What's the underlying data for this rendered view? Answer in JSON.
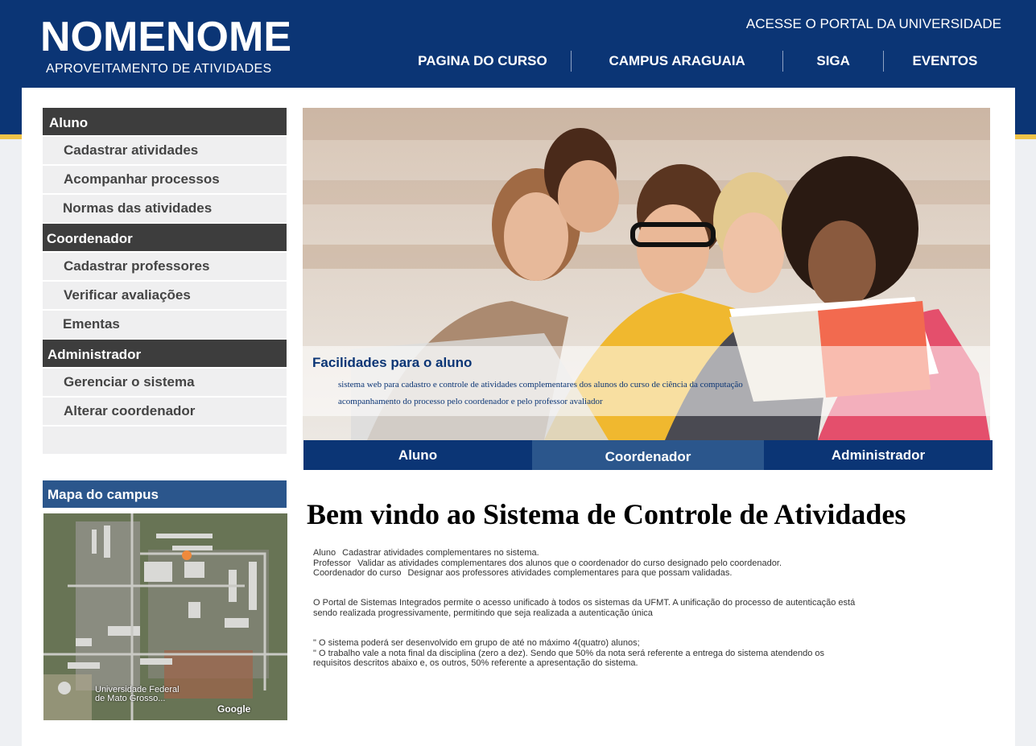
{
  "header": {
    "title": "NOMENOME",
    "subtitle": "APROVEITAMENTO DE ATIVIDADES",
    "portal_link": "ACESSE O PORTAL DA UNIVERSIDADE",
    "nav": [
      "PAGINA DO CURSO",
      "CAMPUS ARAGUAIA",
      "SIGA",
      "EVENTOS"
    ]
  },
  "sidebar": {
    "groups": [
      {
        "title": "Aluno",
        "items": [
          "Cadastrar atividades",
          "Acompanhar processos",
          "Normas das atividades"
        ]
      },
      {
        "title": "Coordenador",
        "items": [
          "Cadastrar professores",
          "Verificar avaliações",
          "Ementas"
        ]
      },
      {
        "title": "Administrador",
        "items": [
          "Gerenciar o sistema",
          "Alterar coordenador"
        ]
      }
    ]
  },
  "map": {
    "title": "Mapa do campus",
    "label_line1": "Universidade Federal",
    "label_line2": "de Mato Grosso...",
    "brand": "Google"
  },
  "hero": {
    "title": "Facilidades para o aluno",
    "line1": "sistema web para cadastro e controle de atividades complementares dos alunos do curso de ciência da computação",
    "line2": "acompanhamento do processo pelo coordenador e pelo professor avaliador"
  },
  "tabs": {
    "items": [
      "Aluno",
      "Coordenador",
      "Administrador"
    ],
    "active": "Coordenador"
  },
  "main": {
    "welcome": "Bem vindo ao Sistema de Controle de Atividades",
    "roles": [
      {
        "role": "Aluno",
        "desc": "Cadastrar atividades complementares no sistema."
      },
      {
        "role": "Professor",
        "desc": "Validar as atividades complementares dos alunos que o coordenador do curso designado pelo coordenador."
      },
      {
        "role": "Coordenador do curso",
        "desc": "Designar aos professores atividades complementares para que possam validadas."
      }
    ],
    "portal_p1": "O Portal de Sistemas Integrados permite o acesso unificado à todos os sistemas da UFMT. A unificação do processo de autenticação está",
    "portal_p2": "sendo realizada progressivamente, permitindo que seja realizada a autenticação única",
    "rule1": "\"   O sistema poderá ser desenvolvido em grupo de até no máximo 4(quatro) alunos;",
    "rule2": "\"   O trabalho vale a nota final da disciplina (zero a dez). Sendo que 50% da nota será referente a entrega do sistema atendendo os",
    "rule3": "requisitos descritos abaixo e, os outros, 50% referente a apresentação do sistema."
  },
  "colors": {
    "brand_blue": "#0b3575",
    "accent_blue": "#2b568c",
    "gold": "#f0c348",
    "dark_header": "#3d3d3d"
  }
}
